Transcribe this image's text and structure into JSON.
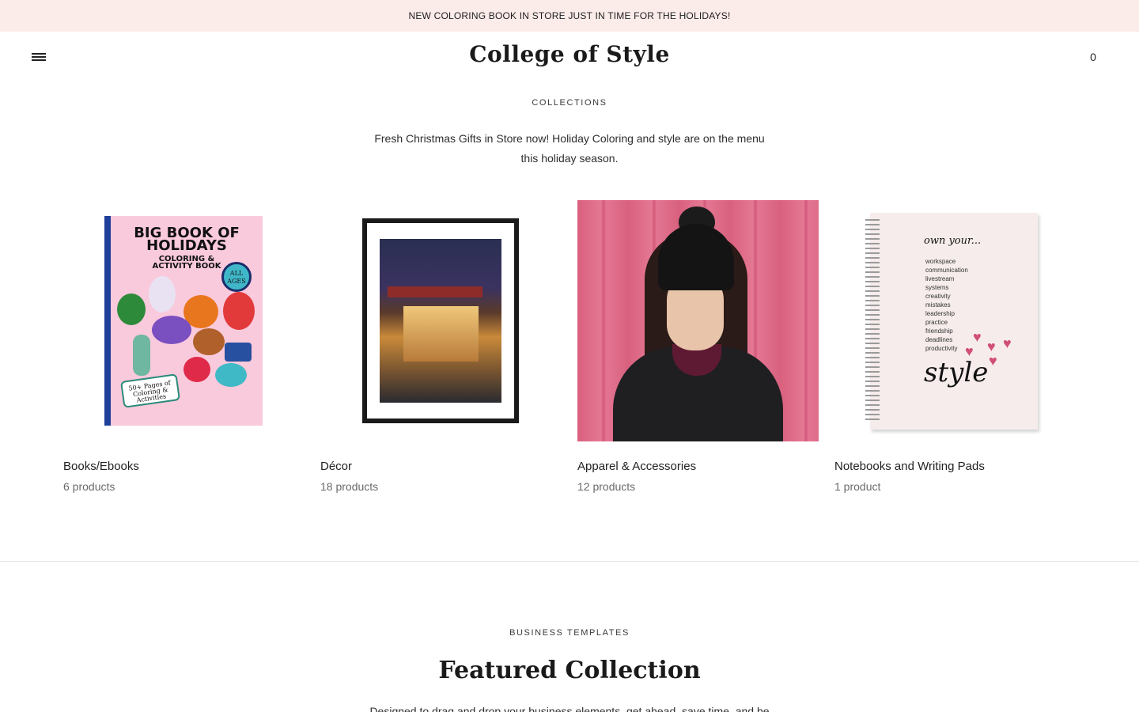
{
  "announcement": "NEW COLORING BOOK IN STORE JUST IN TIME FOR THE HOLIDAYS!",
  "header": {
    "logo": "College of Style",
    "cart_count": "0",
    "menu_icon": "hamburger-menu-icon"
  },
  "collections": {
    "label": "COLLECTIONS",
    "intro": "Fresh Christmas Gifts in Store now! Holiday Coloring and style are on the menu this holiday season.",
    "items": [
      {
        "title": "Books/Ebooks",
        "count": "6 products",
        "image": {
          "line1": "BIG BOOK OF",
          "line2": "HOLIDAYS",
          "line3": "COLORING &",
          "line4": "ACTIVITY BOOK",
          "badge1": "ALL",
          "badge2": "AGES",
          "pages1": "50+ Pages of",
          "pages2": "Coloring &",
          "pages3": "Activities"
        }
      },
      {
        "title": "Décor",
        "count": "18 products"
      },
      {
        "title": "Apparel & Accessories",
        "count": "12 products"
      },
      {
        "title": "Notebooks and Writing Pads",
        "count": "1 product",
        "image": {
          "heading": "own your...",
          "list": [
            "workspace",
            "communication",
            "livestream",
            "systems",
            "creativity",
            "mistakes",
            "leadership",
            "practice",
            "friendship",
            "deadlines",
            "productivity"
          ],
          "word": "style"
        }
      }
    ]
  },
  "featured": {
    "label": "BUSINESS TEMPLATES",
    "title": "Featured Collection",
    "description": "Designed to drag and drop your business elements, get ahead, save time, and be"
  },
  "colors": {
    "announcement_bg": "#fbecea",
    "text": "#2b2b2b",
    "muted": "#6a6a6a"
  }
}
